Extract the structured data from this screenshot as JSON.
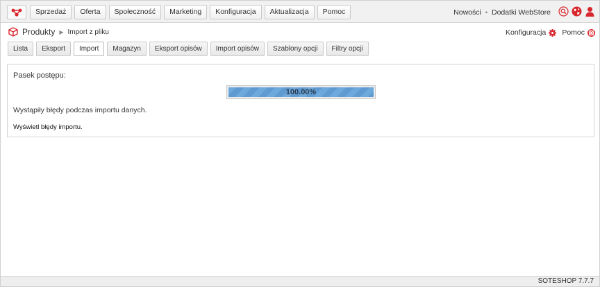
{
  "nav": {
    "items": [
      {
        "label": "Sprzedaż"
      },
      {
        "label": "Oferta"
      },
      {
        "label": "Społeczność"
      },
      {
        "label": "Marketing"
      },
      {
        "label": "Konfiguracja"
      },
      {
        "label": "Aktualizacja"
      },
      {
        "label": "Pomoc"
      }
    ],
    "news_label": "Nowości",
    "separator": "•",
    "addons_label": "Dodatki WebStore"
  },
  "breadcrumb": {
    "section": "Produkty",
    "arrow": "▶",
    "page": "Import z pliku"
  },
  "tools": {
    "config_label": "Konfiguracja",
    "help_label": "Pomoc"
  },
  "tabs": [
    {
      "label": "Lista",
      "active": false
    },
    {
      "label": "Eksport",
      "active": false
    },
    {
      "label": "Import",
      "active": true
    },
    {
      "label": "Magazyn",
      "active": false
    },
    {
      "label": "Eksport opisów",
      "active": false
    },
    {
      "label": "Import opisów",
      "active": false
    },
    {
      "label": "Szablony opcji",
      "active": false
    },
    {
      "label": "Filtry opcji",
      "active": false
    }
  ],
  "progress": {
    "label": "Pasek postępu:",
    "value_text": "100.00%",
    "fraction": 1.0
  },
  "messages": {
    "error": "Wystąpiły błędy podczas importu danych.",
    "show_errors_link": "Wyświetl błędy importu."
  },
  "footer": {
    "version": "SOTESHOP 7.7.7"
  },
  "colors": {
    "accent_red": "#d9272e",
    "progress_blue": "#6ea9dc"
  },
  "icons": {
    "logo": "soteshop-logo-icon",
    "search": "search-icon",
    "globe": "globe-icon",
    "user": "user-icon",
    "cube": "cube-icon",
    "gear": "gear-icon",
    "help": "lifebuoy-icon"
  }
}
